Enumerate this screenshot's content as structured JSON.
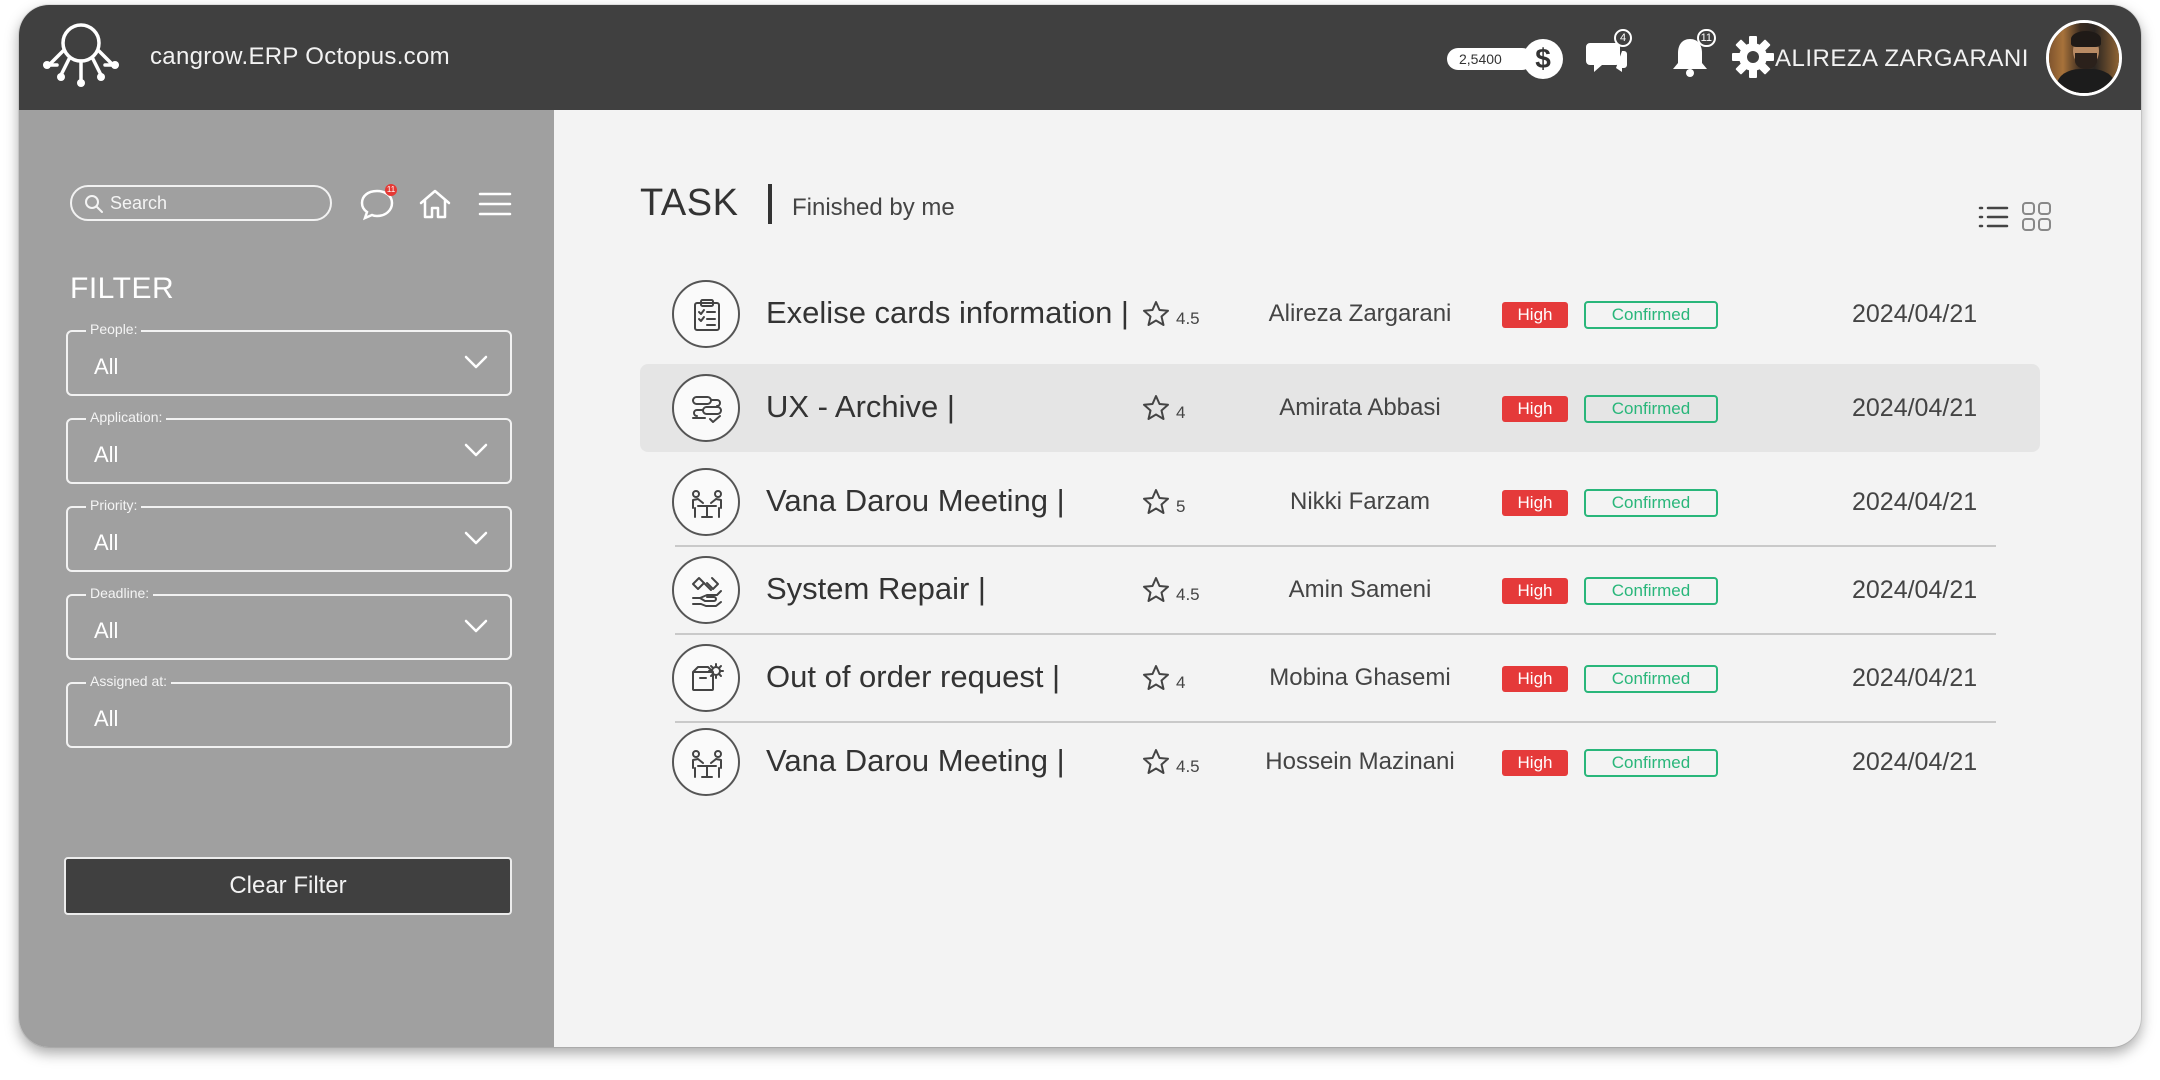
{
  "header": {
    "site_title": "cangrow.ERP Octopus.com",
    "coins": "2,5400",
    "currency_symbol": "$",
    "messages_badge": "4",
    "notifications_badge": "11",
    "user_name": "ALIREZA ZARGARANI"
  },
  "sidebar": {
    "search_placeholder": "Search",
    "chat_badge": "11",
    "filter_title": "FILTER",
    "filters": [
      {
        "label": "People:",
        "value": "All",
        "dropdown": true
      },
      {
        "label": "Application:",
        "value": "All",
        "dropdown": true
      },
      {
        "label": "Priority:",
        "value": "All",
        "dropdown": true
      },
      {
        "label": "Deadline:",
        "value": "All",
        "dropdown": true
      },
      {
        "label": "Assigned at:",
        "value": "All",
        "dropdown": false
      }
    ],
    "clear_label": "Clear Filter"
  },
  "main": {
    "title": "TASK",
    "subtitle": "Finished by me",
    "tasks": [
      {
        "icon": "clipboard-icon",
        "title": "Exelise cards information |",
        "rating": "4.5",
        "person": "Alireza Zargarani",
        "priority": "High",
        "status": "Confirmed",
        "date": "2024/04/21"
      },
      {
        "icon": "workflow-icon",
        "title": "UX - Archive |",
        "rating": "4",
        "person": "Amirata Abbasi",
        "priority": "High",
        "status": "Confirmed",
        "date": "2024/04/21"
      },
      {
        "icon": "meeting-icon",
        "title": "Vana Darou Meeting |",
        "rating": "5",
        "person": "Nikki Farzam",
        "priority": "High",
        "status": "Confirmed",
        "date": "2024/04/21"
      },
      {
        "icon": "repair-icon",
        "title": "System Repair |",
        "rating": "4.5",
        "person": "Amin Sameni",
        "priority": "High",
        "status": "Confirmed",
        "date": "2024/04/21"
      },
      {
        "icon": "request-icon",
        "title": "Out of order request |",
        "rating": "4",
        "person": "Mobina Ghasemi",
        "priority": "High",
        "status": "Confirmed",
        "date": "2024/04/21"
      },
      {
        "icon": "meeting-icon",
        "title": "Vana Darou Meeting |",
        "rating": "4.5",
        "person": "Hossein Mazinani",
        "priority": "High",
        "status": "Confirmed",
        "date": "2024/04/21"
      }
    ]
  },
  "colors": {
    "topbar": "#404040",
    "sidebar": "#a0a0a0",
    "main_bg": "#f3f3f3",
    "priority_high": "#e53a3a",
    "status_confirmed": "#29b67a"
  }
}
